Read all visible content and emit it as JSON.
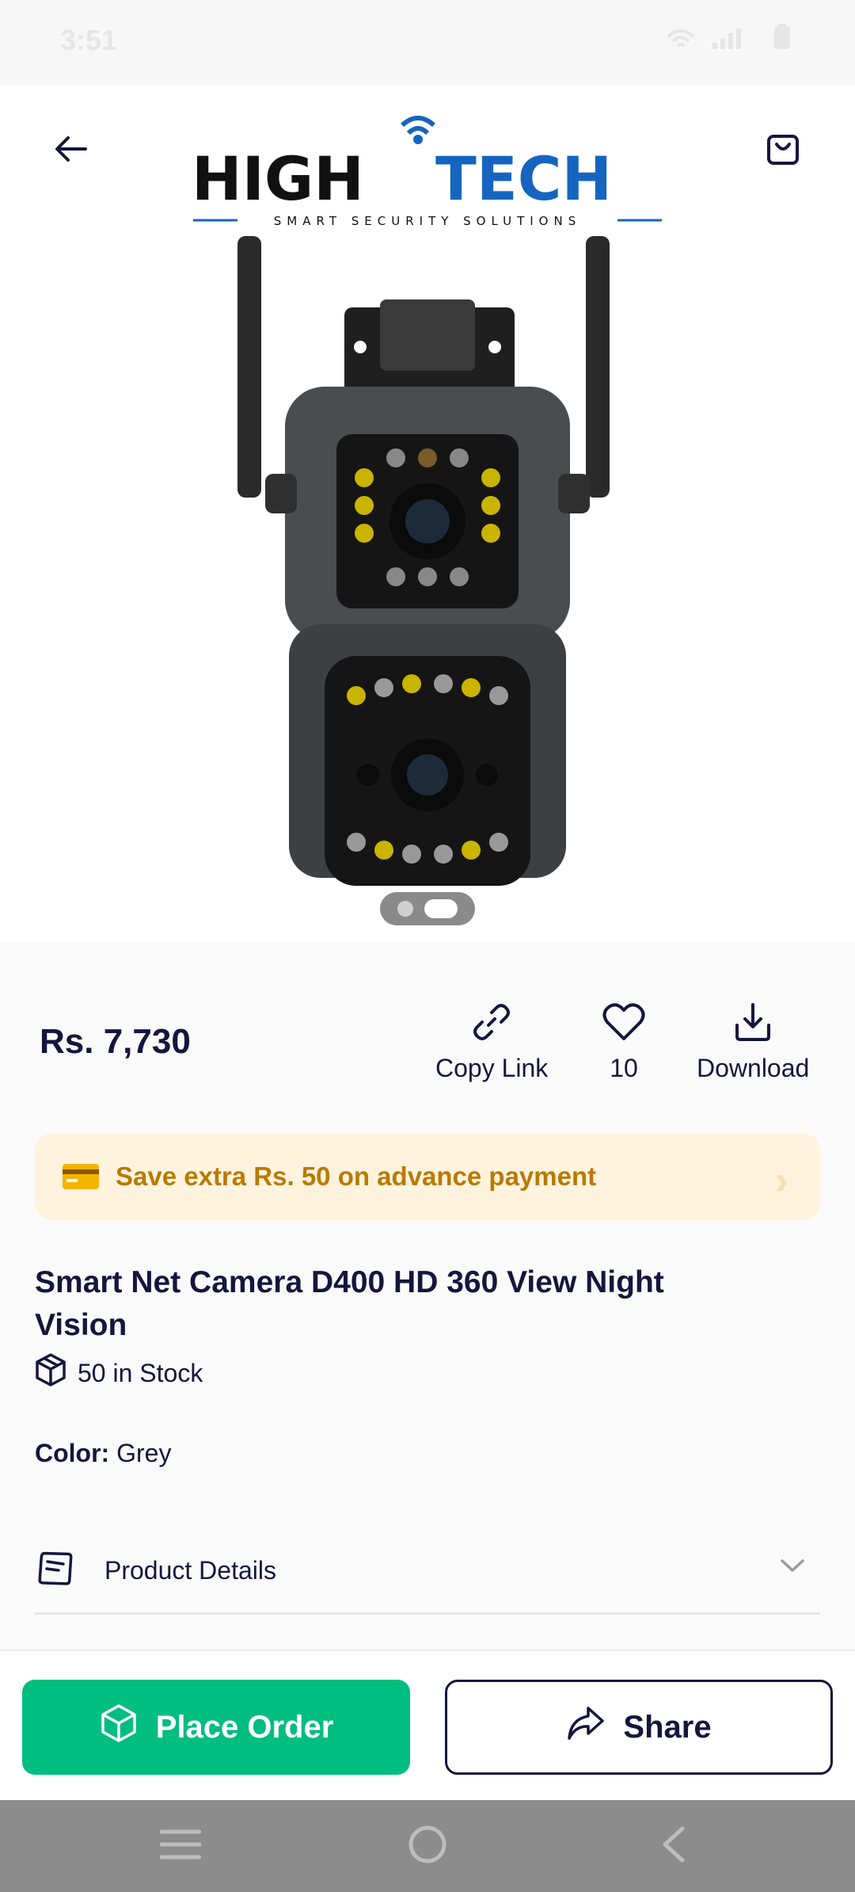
{
  "status_bar": {
    "time": "3:51"
  },
  "brand": {
    "name_left": "HIGH",
    "name_right": "TECH",
    "tagline": "SMART SECURITY SOLUTIONS"
  },
  "product": {
    "price": "Rs. 7,730",
    "title": "Smart Net Camera D400 HD 360 View Night Vision",
    "stock": "50 in Stock",
    "color_label": "Color:",
    "color_value": "Grey"
  },
  "actions": {
    "copy_link": "Copy Link",
    "likes": "10",
    "download": "Download"
  },
  "promo": {
    "text": "Save extra Rs. 50 on advance payment"
  },
  "sections": {
    "product_details": "Product Details"
  },
  "buttons": {
    "place_order": "Place Order",
    "share": "Share"
  },
  "carousel": {
    "slides": 2,
    "active_index": 1
  },
  "colors": {
    "accent_green": "#00bd80",
    "navy": "#14163d",
    "promo_bg": "#fff3dd",
    "promo_text": "#b87a00",
    "brand_blue": "#1565c0"
  }
}
